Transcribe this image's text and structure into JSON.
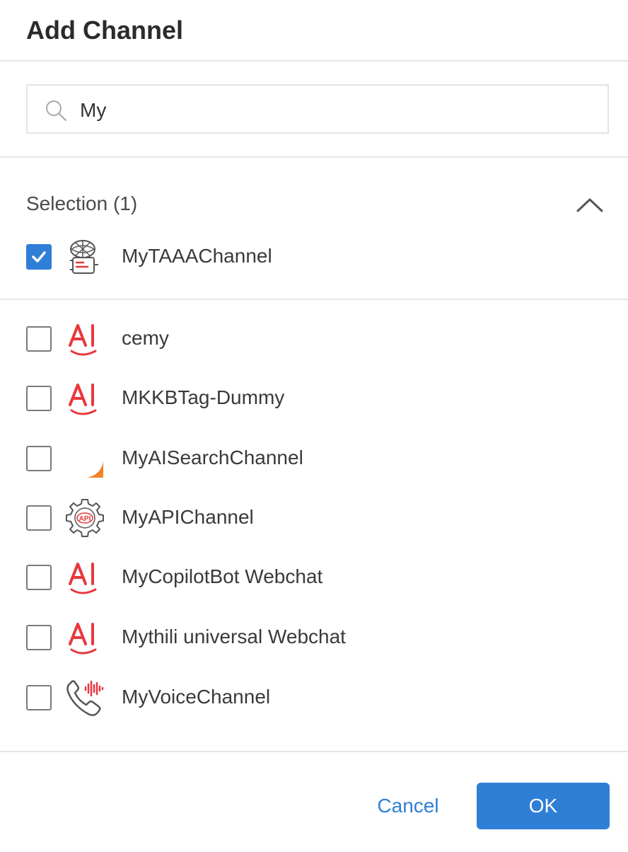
{
  "dialog": {
    "title": "Add Channel"
  },
  "search": {
    "value": "My",
    "icon": "search-icon"
  },
  "selection": {
    "label": "Selection (1)",
    "collapse_icon": "chevron-up-icon",
    "items": [
      {
        "label": "MyTAAAChannel",
        "checked": true,
        "icon": "taaa-channel-icon"
      }
    ]
  },
  "channels": [
    {
      "label": "cemy",
      "checked": false,
      "icon": "ai-webchat-icon"
    },
    {
      "label": "MKKBTag-Dummy",
      "checked": false,
      "icon": "ai-webchat-icon"
    },
    {
      "label": "MyAISearchChannel",
      "checked": false,
      "icon": "ai-search-icon"
    },
    {
      "label": "MyAPIChannel",
      "checked": false,
      "icon": "api-gear-icon"
    },
    {
      "label": "MyCopilotBot Webchat",
      "checked": false,
      "icon": "ai-webchat-icon"
    },
    {
      "label": "Mythili universal Webchat",
      "checked": false,
      "icon": "ai-webchat-icon"
    },
    {
      "label": "MyVoiceChannel",
      "checked": false,
      "icon": "voice-phone-icon"
    }
  ],
  "footer": {
    "cancel_label": "Cancel",
    "ok_label": "OK"
  },
  "colors": {
    "accent": "#2f7fd6",
    "ai_red": "#e8383d",
    "ai_gradient_start": "#ef3b5a",
    "ai_gradient_end": "#f28a1e"
  }
}
